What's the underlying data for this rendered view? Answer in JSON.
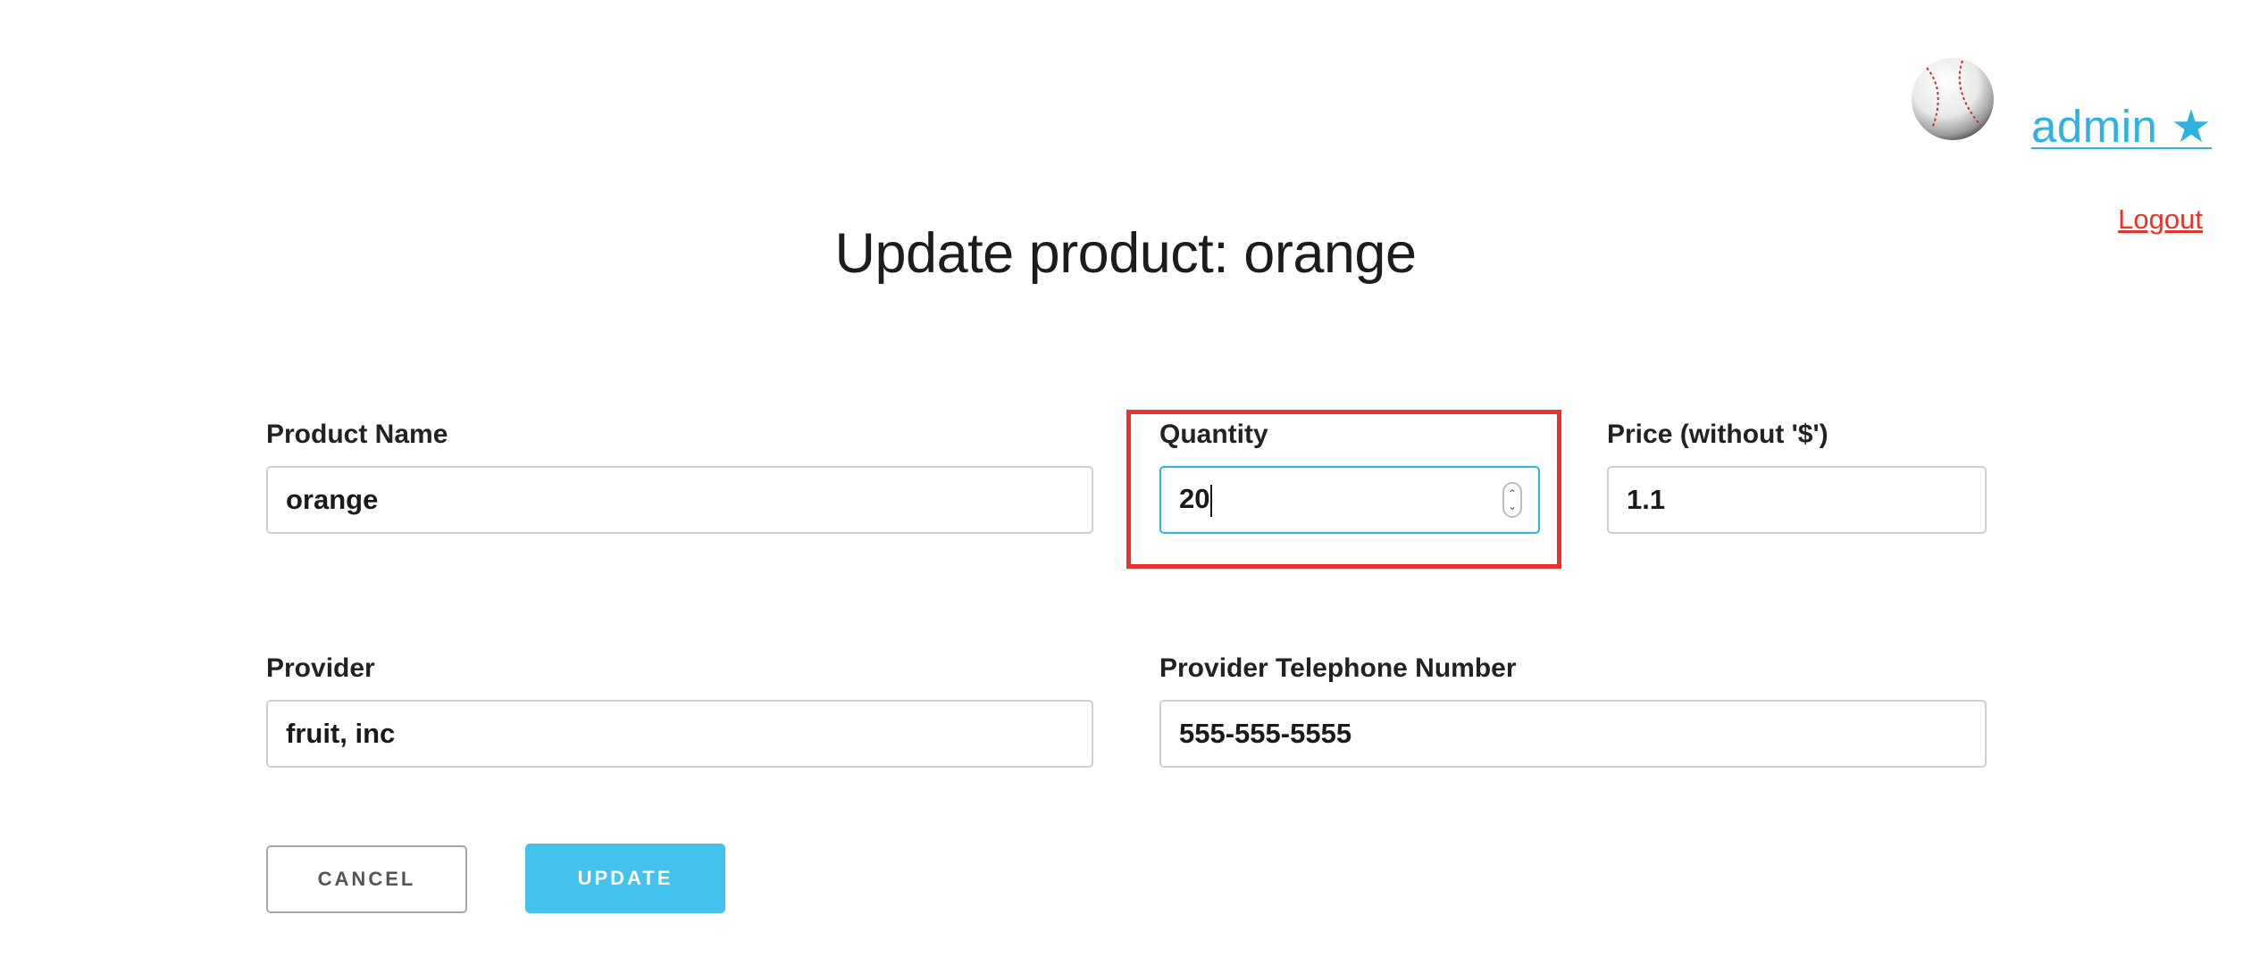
{
  "header": {
    "user_name": "admin",
    "user_star": "★",
    "logout_label": "Logout",
    "avatar_icon": "baseball-icon"
  },
  "page": {
    "title": "Update product: orange"
  },
  "form": {
    "product_name": {
      "label": "Product Name",
      "value": "orange"
    },
    "quantity": {
      "label": "Quantity",
      "value": "20"
    },
    "price": {
      "label": "Price (without '$')",
      "value": "1.1"
    },
    "provider": {
      "label": "Provider",
      "value": "fruit, inc"
    },
    "provider_phone": {
      "label": "Provider Telephone Number",
      "value": "555-555-5555"
    }
  },
  "buttons": {
    "cancel_label": "CANCEL",
    "update_label": "UPDATE"
  },
  "colors": {
    "accent": "#42c2ec",
    "link": "#2fb2e0",
    "highlight": "#e8322a",
    "logout": "#e8322a"
  }
}
